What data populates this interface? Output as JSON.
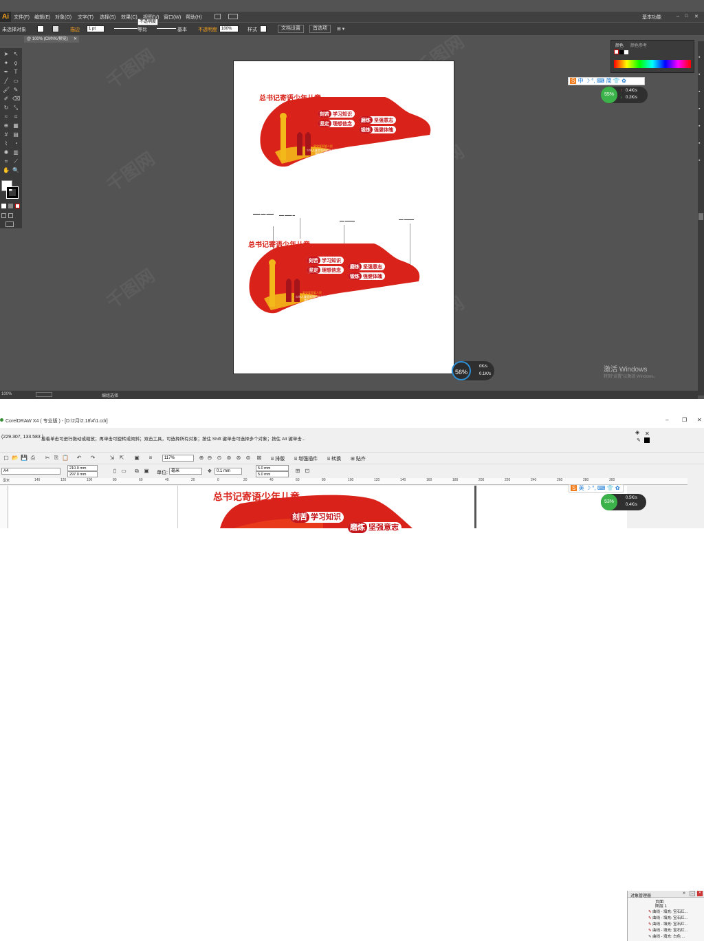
{
  "illustrator": {
    "logo": "Ai",
    "menu": [
      "文件(F)",
      "编辑(E)",
      "对象(O)",
      "文字(T)",
      "选择(S)",
      "效果(C)",
      "视图(V)",
      "窗口(W)",
      "帮助(H)"
    ],
    "workspace": "基本功能",
    "tooltip": "不透明度",
    "control": {
      "no_selection": "未选择对象",
      "stroke_label": "描边",
      "stroke_value": "1 pt",
      "uniform": "等比",
      "basic": "基本",
      "opacity_label": "不透明度",
      "opacity_value": "100%",
      "style_label": "样式",
      "doc_setup": "文档设置",
      "preferences": "首选项"
    },
    "doc_tab": "@ 100% (CMYK/预览)",
    "status_zoom": "100%",
    "status_text": "编组选择",
    "color_panel": {
      "tab1": "颜色",
      "tab2": "颜色参考"
    },
    "ime": {
      "brand": "S",
      "lang": "中",
      "simp": "简"
    },
    "net1": {
      "percent": "55%",
      "up": "0.4K/s",
      "down": "0.2K/s"
    },
    "net2": {
      "percent": "56%",
      "up": "0K/s",
      "down": "0.1K/s"
    },
    "activate": {
      "title": "激活 Windows",
      "sub": "转到\"设置\"以激活 Windows。"
    }
  },
  "design": {
    "title": "总书记寄语少年儿童",
    "pills": [
      {
        "hl": "刻苦",
        "rest": "学习知识"
      },
      {
        "hl": "坚定",
        "rest": "理想信念"
      },
      {
        "hl": "磨炼",
        "rest": "坚强意志"
      },
      {
        "hl": "锻炼",
        "rest": "强健体魄"
      }
    ],
    "small1": "爱党爱国爱人民",
    "small2": "少年儿童是祖国的未来是民族的希望",
    "small3": "我们伟大民族的希望"
  },
  "coreldraw": {
    "title": "CorelDRAW X4 ( 专业版 ) - [D:\\2月\\2.18\\4\\1.cdr]",
    "coords": "(229.307, 133.583 )",
    "hint": "接着单击可进行拖动或缩放；再单击可旋转或倾斜；双击工具，可选择所有对象；按住 Shift 键单击可选择多个对象；按住 Alt 键单击...",
    "zoom": "117%",
    "page_size": "A4",
    "width": "210.0 mm",
    "height": "297.0 mm",
    "unit_label": "单位:",
    "unit": "毫米",
    "nudge": "0.1 mm",
    "dup_x": "5.0 mm",
    "dup_y": "5.0 mm",
    "menu_btns": [
      "排版",
      "增强插件",
      "转换",
      "贴齐"
    ],
    "ruler": [
      "140",
      "120",
      "100",
      "80",
      "60",
      "40",
      "20",
      "0",
      "20",
      "40",
      "60",
      "80",
      "100",
      "120",
      "140",
      "160",
      "180",
      "200",
      "220",
      "240",
      "260",
      "280",
      "300"
    ],
    "ruler_unit": "毫米",
    "obj_mgr": {
      "title": "对象管理器",
      "layer": "图层 1",
      "page_label": "页面:",
      "items": [
        "曲线 - 填充: 宝石红...",
        "曲线 - 填充: 宝石红...",
        "曲线 - 填充: 宝石红...",
        "曲线 - 填充: 宝石红...",
        "曲线 - 填充: 白色 ..."
      ]
    },
    "ime": {
      "brand": "S",
      "lang": "英"
    },
    "net": {
      "percent": "53%",
      "up": "0.5K/s",
      "down": "0.4K/s"
    }
  },
  "colors": {
    "red": "#d9231a",
    "deep_red": "#c4161c",
    "gold": "#f3b81a",
    "ai_bg": "#535353"
  }
}
